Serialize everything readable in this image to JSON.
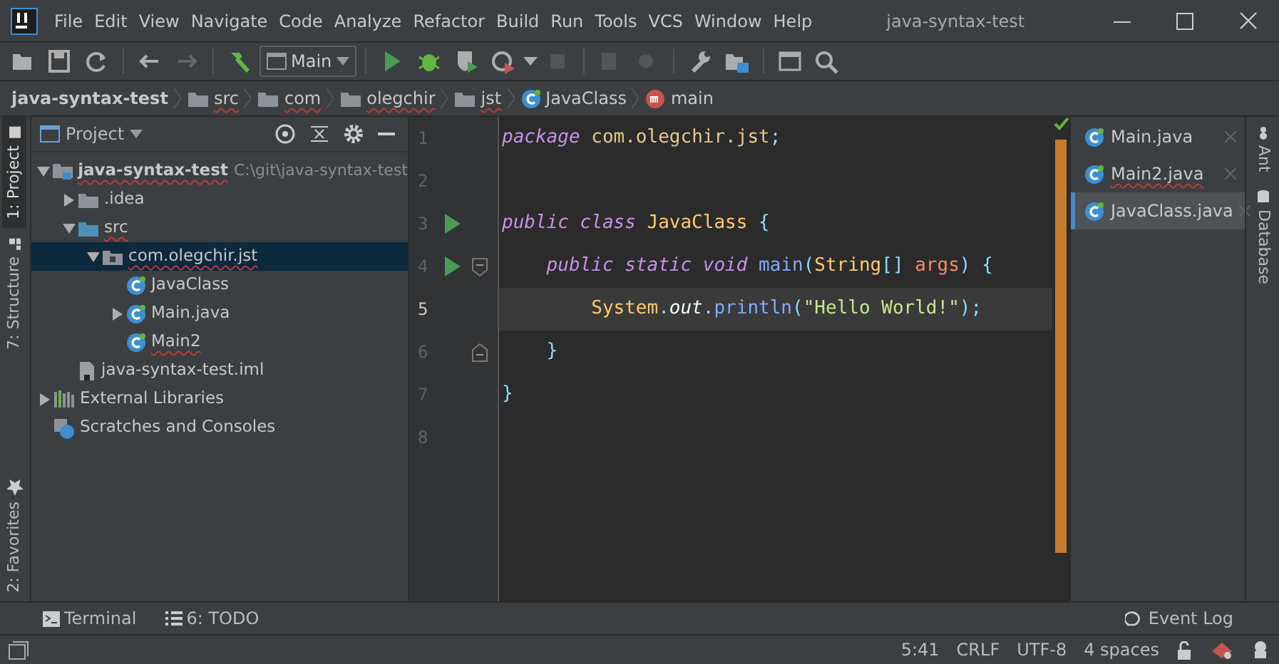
{
  "window": {
    "title": "java-syntax-test",
    "menu": [
      "File",
      "Edit",
      "View",
      "Navigate",
      "Code",
      "Analyze",
      "Refactor",
      "Build",
      "Run",
      "Tools",
      "VCS",
      "Window",
      "Help"
    ]
  },
  "toolbar": {
    "run_configuration": "Main"
  },
  "breadcrumbs": [
    {
      "label": "java-syntax-test",
      "kind": "project",
      "error": false
    },
    {
      "label": "src",
      "kind": "folder",
      "error": true
    },
    {
      "label": "com",
      "kind": "folder",
      "error": true
    },
    {
      "label": "olegchir",
      "kind": "folder",
      "error": true
    },
    {
      "label": "jst",
      "kind": "folder",
      "error": true
    },
    {
      "label": "JavaClass",
      "kind": "class",
      "error": false
    },
    {
      "label": "main",
      "kind": "method",
      "error": false
    }
  ],
  "left_tool_tabs": [
    {
      "label": "1: Project",
      "selected": true
    },
    {
      "label": "7: Structure",
      "selected": false
    }
  ],
  "favorites_tab": {
    "label": "2: Favorites"
  },
  "project_panel": {
    "title": "Project",
    "tree": [
      {
        "label": "java-syntax-test",
        "path": "C:\\git\\java-syntax-test",
        "kind": "module",
        "expanded": true,
        "selected": false,
        "error": true,
        "children": [
          {
            "label": ".idea",
            "kind": "folder",
            "expanded": false,
            "selected": false,
            "error": false
          },
          {
            "label": "src",
            "kind": "source-folder",
            "expanded": true,
            "selected": false,
            "error": true,
            "children": [
              {
                "label": "com.olegchir.jst",
                "kind": "package",
                "expanded": true,
                "selected": true,
                "error": true,
                "children": [
                  {
                    "label": "JavaClass",
                    "kind": "class",
                    "selected": false,
                    "error": false
                  },
                  {
                    "label": "Main.java",
                    "kind": "class",
                    "expanded": false,
                    "selected": false,
                    "error": false
                  },
                  {
                    "label": "Main2",
                    "kind": "class",
                    "selected": false,
                    "error": true
                  }
                ]
              }
            ]
          },
          {
            "label": "java-syntax-test.iml",
            "kind": "file",
            "selected": false,
            "error": false
          }
        ]
      },
      {
        "label": "External Libraries",
        "kind": "libraries",
        "expanded": false,
        "selected": false,
        "error": false
      },
      {
        "label": "Scratches and Consoles",
        "kind": "scratches",
        "selected": false,
        "error": false
      }
    ]
  },
  "editor": {
    "lines": [
      {
        "number": "1",
        "current": false,
        "run_marker": false,
        "kind": "plain",
        "tokens": [
          {
            "text": "package",
            "kind": "keyword"
          },
          {
            "text": " com.olegchir.jst",
            "kind": "package"
          },
          {
            "text": ";",
            "kind": "punct"
          }
        ]
      },
      {
        "number": "2",
        "current": false,
        "run_marker": false,
        "kind": "plain"
      },
      {
        "number": "3",
        "current": false,
        "run_marker": true,
        "kind": "plain",
        "tokens": [
          {
            "text": "public class ",
            "kind": "keyword"
          },
          {
            "text": "JavaClass ",
            "kind": "type"
          },
          {
            "text": "{",
            "kind": "punct"
          }
        ]
      },
      {
        "number": "4",
        "current": false,
        "run_marker": true,
        "kind": "fold-start",
        "tokens": [
          {
            "text": "    public static void ",
            "kind": "keyword"
          },
          {
            "text": "main",
            "kind": "method"
          },
          {
            "text": "(",
            "kind": "punct"
          },
          {
            "text": "String",
            "kind": "type"
          },
          {
            "text": "[] ",
            "kind": "punct"
          },
          {
            "text": "args",
            "kind": "param"
          },
          {
            "text": ") {",
            "kind": "punct"
          }
        ]
      },
      {
        "number": "5",
        "current": true,
        "run_marker": false,
        "kind": "plain",
        "tokens": [
          {
            "text": "        System",
            "kind": "type"
          },
          {
            "text": ".",
            "kind": "punct"
          },
          {
            "text": "out",
            "kind": "field"
          },
          {
            "text": ".",
            "kind": "punct"
          },
          {
            "text": "println",
            "kind": "method"
          },
          {
            "text": "(",
            "kind": "punct"
          },
          {
            "text": "\"Hello World!\"",
            "kind": "string"
          },
          {
            "text": ");",
            "kind": "punct"
          }
        ]
      },
      {
        "number": "6",
        "current": false,
        "run_marker": false,
        "kind": "fold-end",
        "tokens": [
          {
            "text": "    }",
            "kind": "punct"
          }
        ]
      },
      {
        "number": "7",
        "current": false,
        "run_marker": false,
        "kind": "plain",
        "tokens": [
          {
            "text": "}",
            "kind": "punct"
          }
        ]
      },
      {
        "number": "8",
        "current": false,
        "run_marker": false,
        "kind": "plain"
      }
    ]
  },
  "editor_tabs": [
    {
      "label": "Main.java",
      "selected": false,
      "error": false
    },
    {
      "label": "Main2.java",
      "selected": false,
      "error": true
    },
    {
      "label": "JavaClass.java",
      "selected": true,
      "error": false
    }
  ],
  "right_tool_tabs": [
    "Ant",
    "Database"
  ],
  "bottom_tool_tabs": [
    "Terminal",
    "6: TODO"
  ],
  "event_log": "Event Log",
  "status_bar": [
    "5:41",
    "CRLF",
    "UTF-8",
    "4 spaces"
  ]
}
